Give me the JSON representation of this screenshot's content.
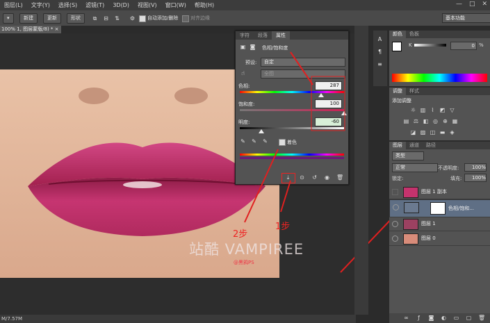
{
  "menu": [
    "图层(L)",
    "文字(Y)",
    "选择(S)",
    "滤镜(T)",
    "3D(D)",
    "视图(V)",
    "窗口(W)",
    "帮助(H)"
  ],
  "window_controls": [
    "—",
    "□",
    "✕"
  ],
  "options_bar": {
    "new_label": "新建",
    "update_label": "更新",
    "shape_label": "形状",
    "auto_add_label": "自动添加/删除",
    "align_edges_label": "对齐边缘",
    "workspace": "基本功能"
  },
  "doc_tab": "100% 1, 图层蒙版/8) * ×",
  "status": "M/7.57M",
  "properties": {
    "tabs": [
      "字符",
      "段落",
      "属性"
    ],
    "title": "色相/饱和度",
    "preset_label": "预设:",
    "preset_value": "自定",
    "channel_value": "全图",
    "hue_label": "色相:",
    "hue_value": "287",
    "sat_label": "饱和度:",
    "sat_value": "100",
    "light_label": "明度:",
    "light_value": "-60",
    "colorize_label": "着色"
  },
  "annotations": {
    "step1": "1步",
    "step2": "2步",
    "watermark": "站酷 VAMPIREE",
    "watermark_sub": "@黑鸦PS"
  },
  "color_panel": {
    "tabs": [
      "颜色",
      "色板"
    ],
    "k_label": "K",
    "k_value": "0",
    "percent": "%"
  },
  "adjust_panel": {
    "tabs": [
      "调整",
      "样式"
    ],
    "title": "添加调整"
  },
  "layers_panel": {
    "tabs": [
      "图层",
      "通道",
      "路径"
    ],
    "kind_label": "类型",
    "blend_mode": "正常",
    "opacity_label": "不透明度:",
    "opacity_value": "100%",
    "lock_label": "锁定:",
    "fill_label": "填充:",
    "fill_value": "100%",
    "layers": [
      {
        "name": "图层 1 副本"
      },
      {
        "name": "色相/饱和..."
      },
      {
        "name": "图层 1"
      },
      {
        "name": "图层 0"
      }
    ]
  },
  "colors": {
    "lip": "#c5336d",
    "arrow": "#e02020",
    "selected_layer": "#5f6f85"
  }
}
